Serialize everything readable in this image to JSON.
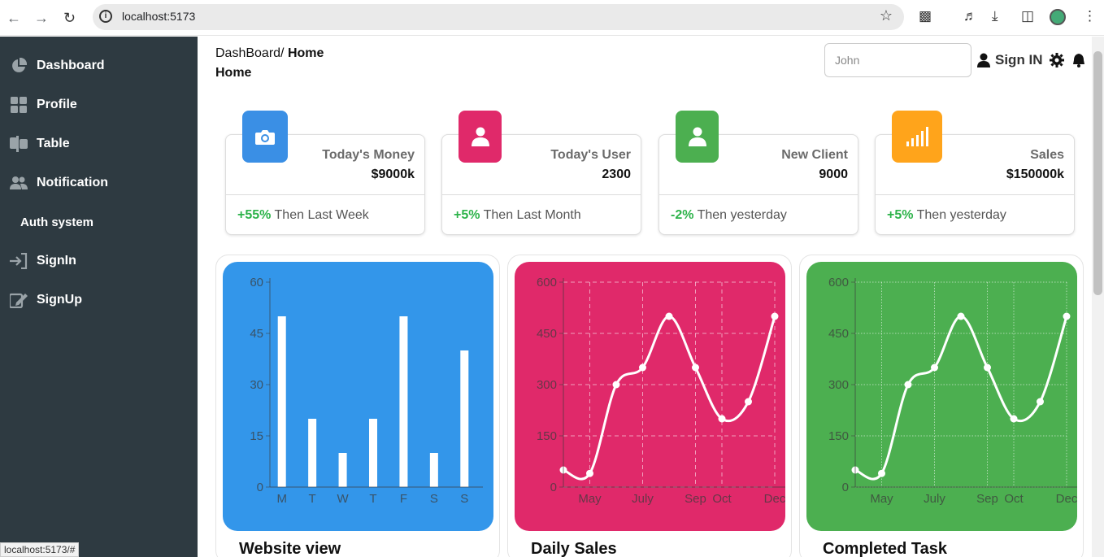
{
  "browser": {
    "url": "localhost:5173",
    "status_url": "localhost:5173/#"
  },
  "sidebar": {
    "items": [
      {
        "label": "Dashboard",
        "icon": "pie-chart-icon"
      },
      {
        "label": "Profile",
        "icon": "grid-icon"
      },
      {
        "label": "Table",
        "icon": "table-icon"
      },
      {
        "label": "Notification",
        "icon": "users-icon"
      }
    ],
    "section": "Auth system",
    "auth_items": [
      {
        "label": "SignIn",
        "icon": "sign-in-icon"
      },
      {
        "label": "SignUp",
        "icon": "sign-up-icon"
      }
    ]
  },
  "header": {
    "breadcrumb_root": "DashBoard/",
    "breadcrumb_current": "Home",
    "title": "Home",
    "search_placeholder": "John",
    "sign_in_label": "Sign IN"
  },
  "stats": [
    {
      "title": "Today's Money",
      "value": "$9000k",
      "change": "+55%",
      "period": "Then Last Week",
      "color": "#3a8fe5",
      "icon": "camera-icon"
    },
    {
      "title": "Today's User",
      "value": "2300",
      "change": "+5%",
      "period": "Then Last Month",
      "color": "#e0296a",
      "icon": "user-icon"
    },
    {
      "title": "New Client",
      "value": "9000",
      "change": "-2%",
      "period": "Then yesterday",
      "color": "#4caf50",
      "icon": "user-icon"
    },
    {
      "title": "Sales",
      "value": "$150000k",
      "change": "+5%",
      "period": "Then yesterday",
      "color": "#ffa41b",
      "icon": "signal-icon"
    }
  ],
  "chart_data": [
    {
      "type": "bar",
      "title": "Website view",
      "color": "#3396ea",
      "categories": [
        "M",
        "T",
        "W",
        "T",
        "F",
        "S",
        "S"
      ],
      "values": [
        50,
        20,
        10,
        20,
        50,
        10,
        40
      ],
      "ylim": [
        0,
        60
      ],
      "yticks": [
        0,
        15,
        30,
        45,
        60
      ],
      "grid": false
    },
    {
      "type": "line",
      "title": "Daily Sales",
      "color": "#e0296a",
      "x": [
        0,
        1,
        2,
        3,
        4,
        5,
        6,
        7,
        8
      ],
      "values": [
        50,
        40,
        300,
        350,
        500,
        350,
        200,
        250,
        500
      ],
      "xtick_labels": [
        {
          "x": 1,
          "label": "May"
        },
        {
          "x": 3,
          "label": "July"
        },
        {
          "x": 5,
          "label": "Sep"
        },
        {
          "x": 6,
          "label": "Oct"
        },
        {
          "x": 8,
          "label": "Dec"
        }
      ],
      "xlim": [
        0,
        8
      ],
      "ylim": [
        0,
        600
      ],
      "yticks": [
        0,
        150,
        300,
        450,
        600
      ],
      "grid": "dashed"
    },
    {
      "type": "line",
      "title": "Completed Task",
      "color": "#4caf50",
      "x": [
        0,
        1,
        2,
        3,
        4,
        5,
        6,
        7,
        8
      ],
      "values": [
        50,
        40,
        300,
        350,
        500,
        350,
        200,
        250,
        500
      ],
      "xtick_labels": [
        {
          "x": 1,
          "label": "May"
        },
        {
          "x": 3,
          "label": "July"
        },
        {
          "x": 5,
          "label": "Sep"
        },
        {
          "x": 6,
          "label": "Oct"
        },
        {
          "x": 8,
          "label": "Dec"
        }
      ],
      "xlim": [
        0,
        8
      ],
      "ylim": [
        0,
        600
      ],
      "yticks": [
        0,
        150,
        300,
        450,
        600
      ],
      "grid": "dotted"
    }
  ]
}
